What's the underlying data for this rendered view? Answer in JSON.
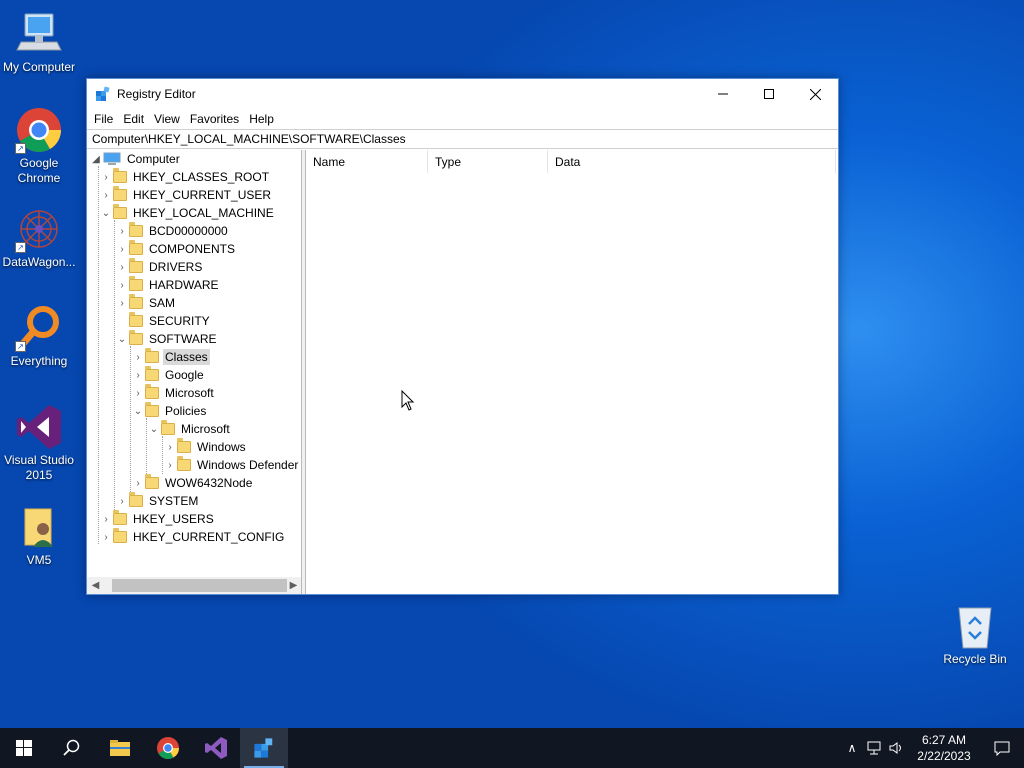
{
  "desktop": {
    "icons": [
      {
        "label": "My Computer"
      },
      {
        "label": "Google Chrome"
      },
      {
        "label": "DataWagon..."
      },
      {
        "label": "Everything"
      },
      {
        "label": "Visual Studio 2015"
      },
      {
        "label": "VM5"
      },
      {
        "label": "Recycle Bin"
      }
    ]
  },
  "window": {
    "title": "Registry Editor",
    "menu": [
      "File",
      "Edit",
      "View",
      "Favorites",
      "Help"
    ],
    "address": "Computer\\HKEY_LOCAL_MACHINE\\SOFTWARE\\Classes",
    "tree": {
      "root": "Computer",
      "items": [
        {
          "label": "HKEY_CLASSES_ROOT",
          "expander": "right"
        },
        {
          "label": "HKEY_CURRENT_USER",
          "expander": "right"
        },
        {
          "label": "HKEY_LOCAL_MACHINE",
          "expander": "down"
        },
        {
          "label": "BCD00000000",
          "expander": "right"
        },
        {
          "label": "COMPONENTS",
          "expander": "right"
        },
        {
          "label": "DRIVERS",
          "expander": "right"
        },
        {
          "label": "HARDWARE",
          "expander": "right"
        },
        {
          "label": "SAM",
          "expander": "right"
        },
        {
          "label": "SECURITY",
          "expander": "none"
        },
        {
          "label": "SOFTWARE",
          "expander": "down"
        },
        {
          "label": "Classes",
          "expander": "right",
          "selected": true
        },
        {
          "label": "Google",
          "expander": "right"
        },
        {
          "label": "Microsoft",
          "expander": "right"
        },
        {
          "label": "Policies",
          "expander": "down"
        },
        {
          "label": "Microsoft",
          "expander": "down"
        },
        {
          "label": "Windows",
          "expander": "right"
        },
        {
          "label": "Windows Defender",
          "expander": "right"
        },
        {
          "label": "WOW6432Node",
          "expander": "right"
        },
        {
          "label": "SYSTEM",
          "expander": "right"
        },
        {
          "label": "HKEY_USERS",
          "expander": "right"
        },
        {
          "label": "HKEY_CURRENT_CONFIG",
          "expander": "right"
        }
      ]
    },
    "columns": [
      "Name",
      "Type",
      "Data"
    ]
  },
  "taskbar": {
    "time": "6:27 AM",
    "date": "2/22/2023"
  },
  "colors": {
    "desktop_bg": "#0a62d4",
    "taskbar_bg": "#101722",
    "folder": "#f8d775",
    "selection": "#d9d9d9"
  }
}
